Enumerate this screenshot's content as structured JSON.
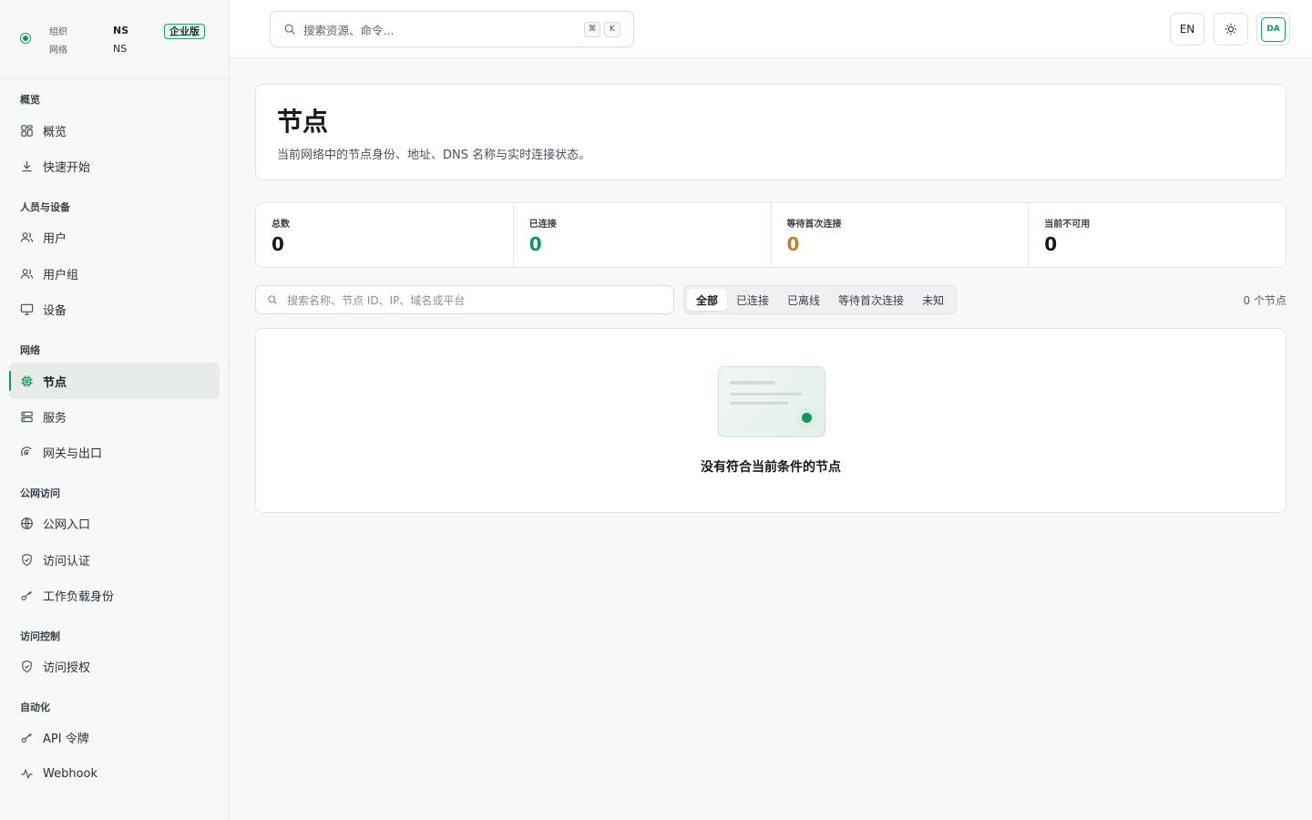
{
  "org": {
    "org_label": "组织",
    "org_value": "NS",
    "network_label": "网络",
    "network_value": "NS",
    "edition_badge": "企业版"
  },
  "sidebar": {
    "sections": [
      {
        "title": "概览",
        "items": [
          {
            "label": "概览",
            "icon": "grid-icon"
          },
          {
            "label": "快速开始",
            "icon": "download-icon"
          }
        ]
      },
      {
        "title": "人员与设备",
        "items": [
          {
            "label": "用户",
            "icon": "users-icon"
          },
          {
            "label": "用户组",
            "icon": "users-icon"
          },
          {
            "label": "设备",
            "icon": "monitor-icon"
          }
        ]
      },
      {
        "title": "网络",
        "items": [
          {
            "label": "节点",
            "icon": "cpu-icon",
            "active": true
          },
          {
            "label": "服务",
            "icon": "server-icon"
          },
          {
            "label": "网关与出口",
            "icon": "gateway-icon"
          }
        ]
      },
      {
        "title": "公网访问",
        "items": [
          {
            "label": "公网入口",
            "icon": "globe-icon"
          },
          {
            "label": "访问认证",
            "icon": "shield-check-icon"
          },
          {
            "label": "工作负载身份",
            "icon": "key-icon"
          }
        ]
      },
      {
        "title": "访问控制",
        "items": [
          {
            "label": "访问授权",
            "icon": "shield-check-icon"
          }
        ]
      },
      {
        "title": "自动化",
        "items": [
          {
            "label": "API 令牌",
            "icon": "key-icon"
          },
          {
            "label": "Webhook",
            "icon": "activity-icon"
          }
        ]
      }
    ]
  },
  "topbar": {
    "search_placeholder": "搜索资源、命令...",
    "shortcut_keys": [
      "⌘",
      "K"
    ],
    "language": "EN",
    "theme_icon": "sun-icon",
    "avatar_initials": "DA"
  },
  "page": {
    "title": "节点",
    "subtitle": "当前网络中的节点身份、地址、DNS 名称与实时连接状态。"
  },
  "stats": [
    {
      "label": "总数",
      "value": "0",
      "color": "#15191d"
    },
    {
      "label": "已连接",
      "value": "0",
      "color": "#13945f"
    },
    {
      "label": "等待首次连接",
      "value": "0",
      "color": "#b8862b"
    },
    {
      "label": "当前不可用",
      "value": "0",
      "color": "#15191d"
    }
  ],
  "filters": {
    "search_placeholder": "搜索名称、节点 ID、IP、域名或平台",
    "tabs": [
      "全部",
      "已连接",
      "已离线",
      "等待首次连接",
      "未知"
    ],
    "active_tab": "全部",
    "count_text": "0 个节点"
  },
  "empty_state": {
    "message": "没有符合当前条件的节点"
  },
  "colors": {
    "accent": "#13945f",
    "pending": "#b8862b"
  }
}
